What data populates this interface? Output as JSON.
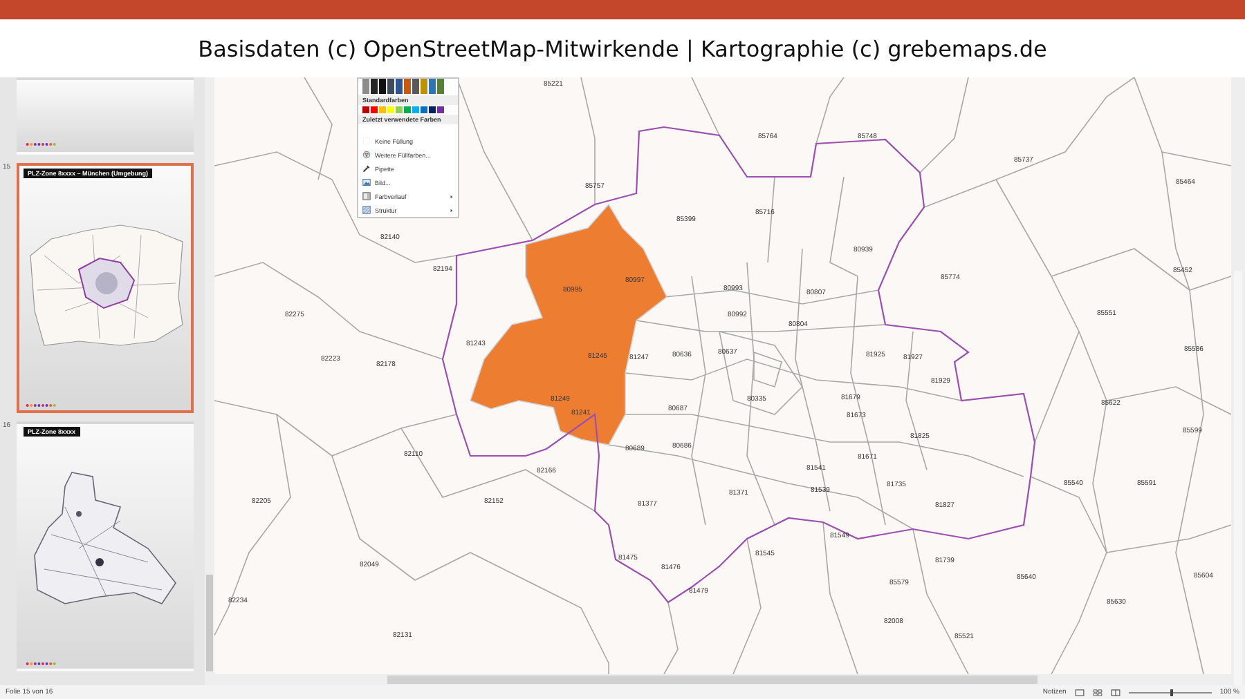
{
  "banner": {
    "text": "Basisdaten (c) OpenStreetMap-Mitwirkende | Kartographie (c) grebemaps.de"
  },
  "slides": [
    {
      "kind": "partial",
      "selected": false
    },
    {
      "kind": "city",
      "number": "15",
      "title": "PLZ-Zone 8xxxx – München (Umgebung)",
      "selected": true
    },
    {
      "kind": "state",
      "number": "16",
      "title": "PLZ-Zone 8xxxx",
      "selected": false
    }
  ],
  "map": {
    "labels": [
      "85221",
      "85764",
      "85748",
      "85737",
      "85757",
      "85399",
      "85464",
      "82140",
      "82194",
      "85716",
      "80939",
      "85774",
      "85452",
      "82275",
      "82223",
      "82178",
      "80995",
      "80997",
      "81245",
      "81247",
      "81243",
      "81249",
      "81241",
      "85551",
      "85586",
      "85622",
      "85599",
      "85540",
      "85591",
      "85604",
      "85630",
      "82110",
      "82205",
      "82152",
      "82166",
      "82049",
      "82234",
      "82131",
      "85521",
      "82008",
      "85579",
      "85640",
      "81739",
      "81549",
      "81545",
      "81377",
      "81475",
      "81476",
      "81479",
      "80689",
      "80686",
      "80687",
      "80636",
      "80637",
      "80335",
      "81673",
      "81679",
      "81825",
      "81827",
      "81735",
      "81671",
      "81541",
      "81539",
      "81371",
      "81927",
      "81929",
      "81925",
      "80807",
      "80804",
      "80992",
      "80993"
    ]
  },
  "color_menu": {
    "theme_colors": [
      {
        "color": "#8c8c8c"
      },
      {
        "color": "#262626"
      },
      {
        "color": "#111111"
      },
      {
        "color": "#3f4a5a"
      },
      {
        "color": "#2f5597"
      },
      {
        "color": "#c55a11"
      },
      {
        "color": "#595959"
      },
      {
        "color": "#bf9000"
      },
      {
        "color": "#2e75b6"
      },
      {
        "color": "#548235"
      }
    ],
    "standard_heading": "Standardfarben",
    "standard_colors": [
      {
        "color": "#c00000"
      },
      {
        "color": "#ff0000"
      },
      {
        "color": "#ffc000"
      },
      {
        "color": "#ffff00"
      },
      {
        "color": "#92d050"
      },
      {
        "color": "#00b050"
      },
      {
        "color": "#00b0f0"
      },
      {
        "color": "#0070c0"
      },
      {
        "color": "#002060"
      },
      {
        "color": "#7030a0"
      }
    ],
    "recent_heading": "Zuletzt verwendete Farben",
    "items": [
      {
        "kind": "none",
        "label": "Keine Füllung",
        "has_submenu": false
      },
      {
        "kind": "more",
        "label": "Weitere Füllfarben...",
        "has_submenu": false
      },
      {
        "kind": "eyedropper",
        "label": "Pipette",
        "has_submenu": false
      },
      {
        "kind": "picture",
        "label": "Bild...",
        "has_submenu": false
      },
      {
        "kind": "gradient",
        "label": "Farbverlauf",
        "has_submenu": true
      },
      {
        "kind": "texture",
        "label": "Struktur",
        "has_submenu": true
      }
    ]
  },
  "status_bar": {
    "slide_info": "Folie 15 von 16",
    "notes": "Notizen",
    "zoom": "100 %",
    "level": 0.5
  }
}
